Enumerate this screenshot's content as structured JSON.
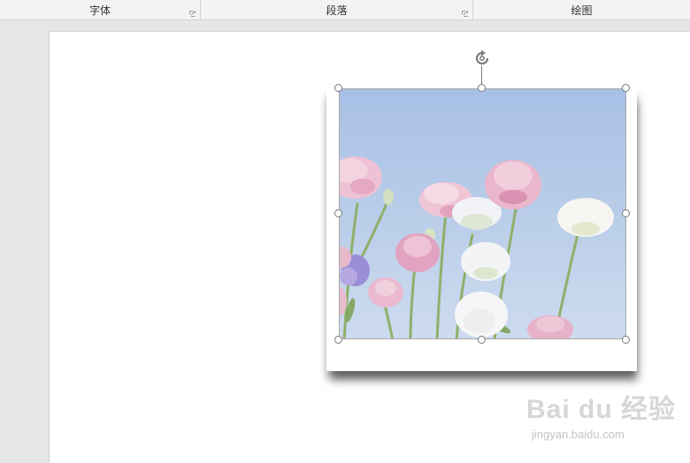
{
  "ribbon": {
    "groups": [
      {
        "label": "字体"
      },
      {
        "label": "段落"
      },
      {
        "label": "绘图"
      }
    ]
  },
  "icons": {
    "launcher": "dialog-launcher-icon",
    "rotate": "rotate-icon"
  },
  "watermark": {
    "brand": "Bai du 经验",
    "url": "jingyan.baidu.com"
  },
  "colors": {
    "page": "#ffffff",
    "workspace": "#e6e6e6",
    "sky": "#b0c7ea",
    "handle_border": "#7a7a7a"
  }
}
